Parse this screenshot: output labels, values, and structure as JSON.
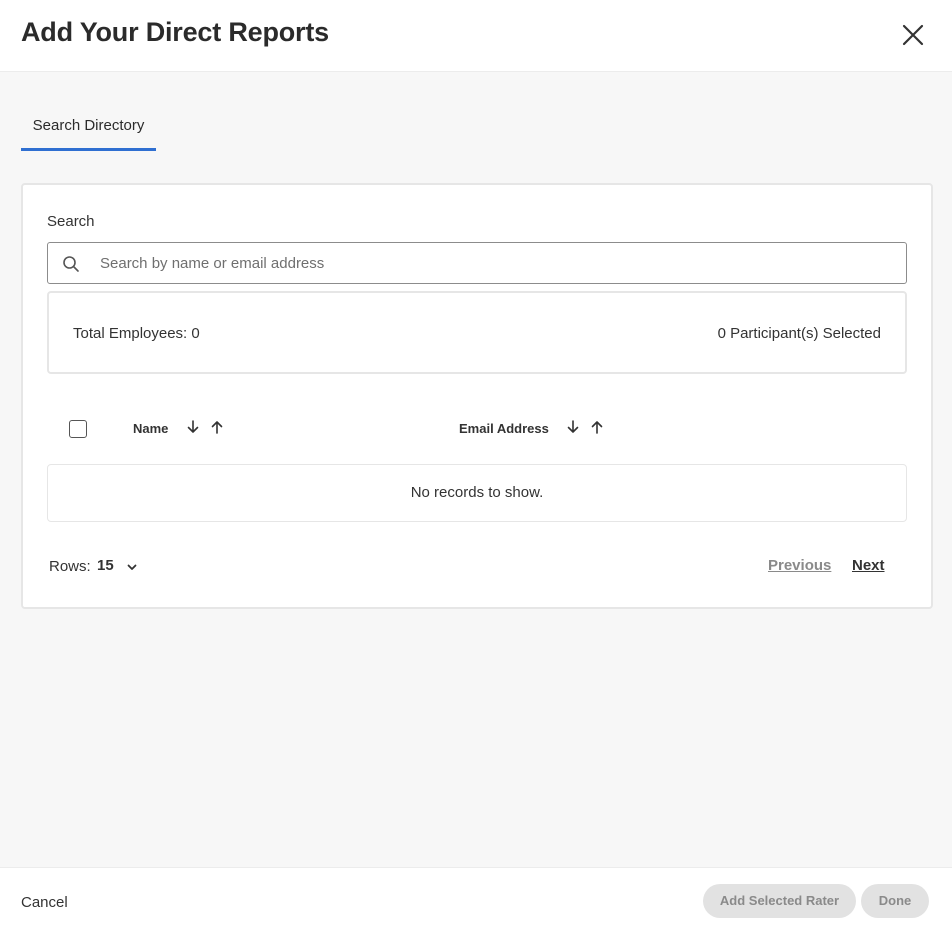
{
  "dialog": {
    "title": "Add Your Direct Reports"
  },
  "tabs": [
    {
      "label": "Search Directory",
      "active": true
    }
  ],
  "search": {
    "label": "Search",
    "placeholder": "Search by name or email address",
    "value": ""
  },
  "summary": {
    "total_employees": "Total Employees: 0",
    "selected_count": "0 Participant(s) Selected"
  },
  "table": {
    "columns": [
      "Name",
      "Email Address"
    ],
    "select_all_checked": false,
    "empty_message": "No records to show."
  },
  "pagination": {
    "rows_label": "Rows:",
    "rows_value": "15",
    "previous": "Previous",
    "next": "Next"
  },
  "footer": {
    "cancel": "Cancel",
    "add_selected": "Add Selected Rater",
    "done": "Done"
  },
  "icons": {
    "close": "close-icon",
    "search": "search-icon",
    "sort_desc": "arrow-down-icon",
    "sort_asc": "arrow-up-icon",
    "rows_dropdown": "chevron-down-icon"
  },
  "colors": {
    "accent": "#2f6fd1",
    "background": "#f7f7f7",
    "disabled_button": "#e2e2e2",
    "disabled_text": "#8a8a8a"
  }
}
